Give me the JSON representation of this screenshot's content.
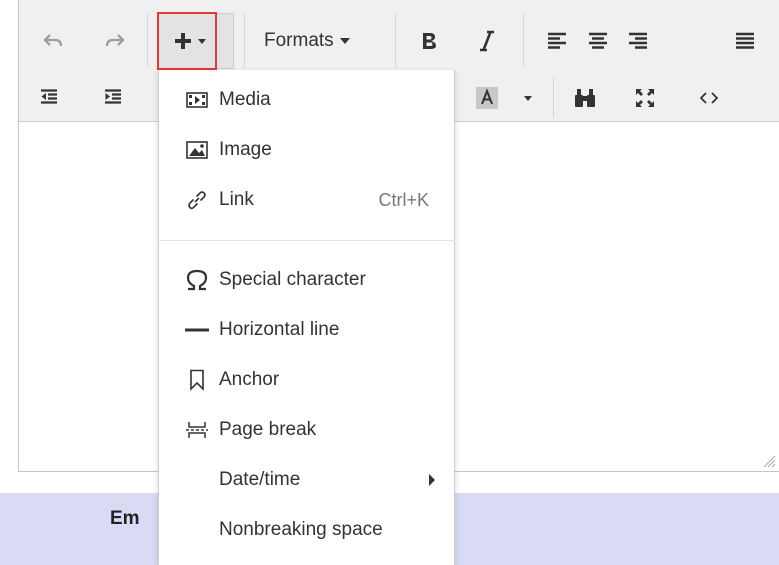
{
  "toolbar": {
    "formats_label": "Formats"
  },
  "insert_menu": {
    "items": [
      {
        "label": "Media",
        "icon": "media-icon"
      },
      {
        "label": "Image",
        "icon": "image-icon"
      },
      {
        "label": "Link",
        "icon": "link-icon",
        "shortcut": "Ctrl+K"
      },
      {
        "label": "Special character",
        "icon": "omega-icon"
      },
      {
        "label": "Horizontal line",
        "icon": "horizontal-line-icon"
      },
      {
        "label": "Anchor",
        "icon": "bookmark-icon"
      },
      {
        "label": "Page break",
        "icon": "page-break-icon"
      },
      {
        "label": "Date/time",
        "icon": "",
        "submenu": true
      },
      {
        "label": "Nonbreaking space",
        "icon": ""
      }
    ]
  },
  "background": {
    "partial_label": "Em"
  },
  "colors": {
    "toolbar_bg": "#f0f0f0",
    "highlight": "#e53935",
    "band": "#d9daf4"
  }
}
